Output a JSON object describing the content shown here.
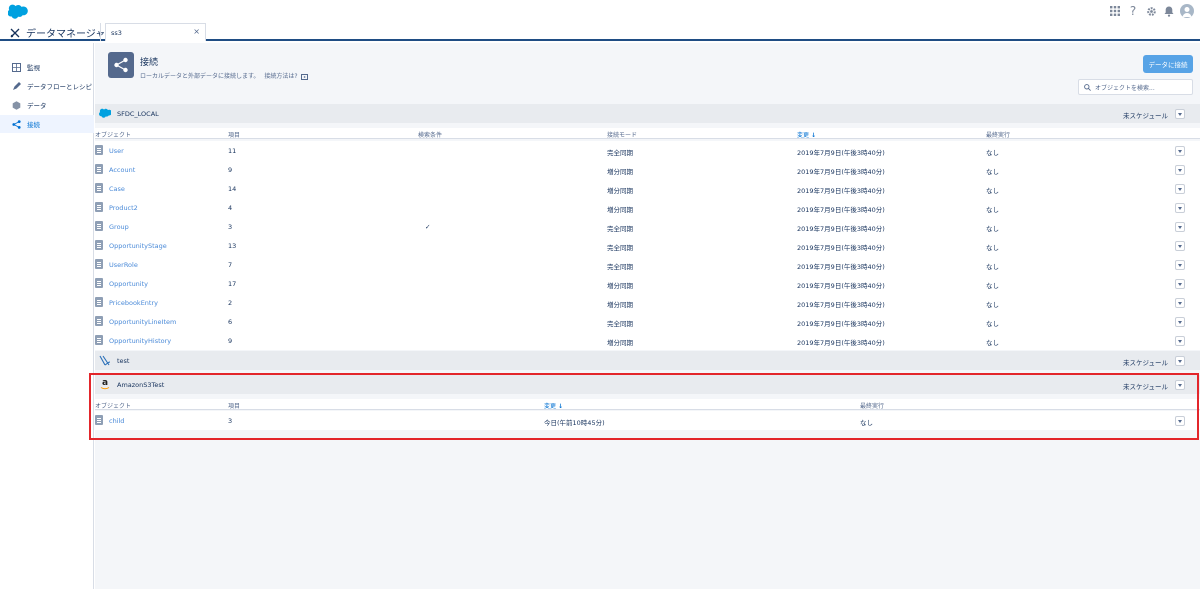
{
  "header": {
    "app_name": "データマネージャ",
    "tab_label": "ss3",
    "tab_close": "×"
  },
  "topbar": {
    "icons": [
      "app-launcher-icon",
      "help-icon",
      "gear-icon",
      "bell-icon",
      "avatar"
    ],
    "help_glyph": "?"
  },
  "sidebar": {
    "items": [
      {
        "label": "監視",
        "icon": "monitor-icon"
      },
      {
        "label": "データフローとレシピ",
        "icon": "pencil-icon"
      },
      {
        "label": "データ",
        "icon": "hexagon-icon"
      },
      {
        "label": "接続",
        "icon": "share-icon",
        "active": true
      }
    ]
  },
  "page": {
    "title": "接続",
    "subtitle": "ローカルデータと外部データに接続します。",
    "help_link": "接続方法は?",
    "connect_button": "データに接続",
    "search_placeholder": "オブジェクトを検索..."
  },
  "groups": [
    {
      "name": "SFDC_LOCAL",
      "icon": "salesforce-cloud-icon",
      "schedule": "未スケジュール",
      "columns": [
        "オブジェクト",
        "項目",
        "検索条件",
        "接続モード",
        "変更",
        "最終実行"
      ],
      "rows": [
        {
          "object": "User",
          "fields": "11",
          "filter": "",
          "mode": "完全同期",
          "changed": "2019年7月9日(午後3時40分)",
          "last_run": "なし"
        },
        {
          "object": "Account",
          "fields": "9",
          "filter": "",
          "mode": "増分同期",
          "changed": "2019年7月9日(午後3時40分)",
          "last_run": "なし"
        },
        {
          "object": "Case",
          "fields": "14",
          "filter": "",
          "mode": "増分同期",
          "changed": "2019年7月9日(午後3時40分)",
          "last_run": "なし"
        },
        {
          "object": "Product2",
          "fields": "4",
          "filter": "",
          "mode": "増分同期",
          "changed": "2019年7月9日(午後3時40分)",
          "last_run": "なし"
        },
        {
          "object": "Group",
          "fields": "3",
          "filter": "✓",
          "mode": "完全同期",
          "changed": "2019年7月9日(午後3時40分)",
          "last_run": "なし"
        },
        {
          "object": "OpportunityStage",
          "fields": "13",
          "filter": "",
          "mode": "完全同期",
          "changed": "2019年7月9日(午後3時40分)",
          "last_run": "なし"
        },
        {
          "object": "UserRole",
          "fields": "7",
          "filter": "",
          "mode": "完全同期",
          "changed": "2019年7月9日(午後3時40分)",
          "last_run": "なし"
        },
        {
          "object": "Opportunity",
          "fields": "17",
          "filter": "",
          "mode": "増分同期",
          "changed": "2019年7月9日(午後3時40分)",
          "last_run": "なし"
        },
        {
          "object": "PricebookEntry",
          "fields": "2",
          "filter": "",
          "mode": "増分同期",
          "changed": "2019年7月9日(午後3時40分)",
          "last_run": "なし"
        },
        {
          "object": "OpportunityLineItem",
          "fields": "6",
          "filter": "",
          "mode": "完全同期",
          "changed": "2019年7月9日(午後3時40分)",
          "last_run": "なし"
        },
        {
          "object": "OpportunityHistory",
          "fields": "9",
          "filter": "",
          "mode": "増分同期",
          "changed": "2019年7月9日(午後3時40分)",
          "last_run": "なし"
        }
      ]
    },
    {
      "name": "test",
      "icon": "connector-icon",
      "schedule": "未スケジュール"
    },
    {
      "name": "AmazonS3Test",
      "icon": "amazon-icon",
      "icon_letter": "a",
      "schedule": "未スケジュール",
      "columns": [
        "オブジェクト",
        "項目",
        "変更",
        "最終実行"
      ],
      "rows": [
        {
          "object": "child",
          "fields": "3",
          "changed": "今日(午前10時45分)",
          "last_run": "なし"
        }
      ]
    }
  ],
  "colors": {
    "accent": "#0070d2",
    "button": "#57a3e6",
    "highlight": "#e3262b"
  }
}
